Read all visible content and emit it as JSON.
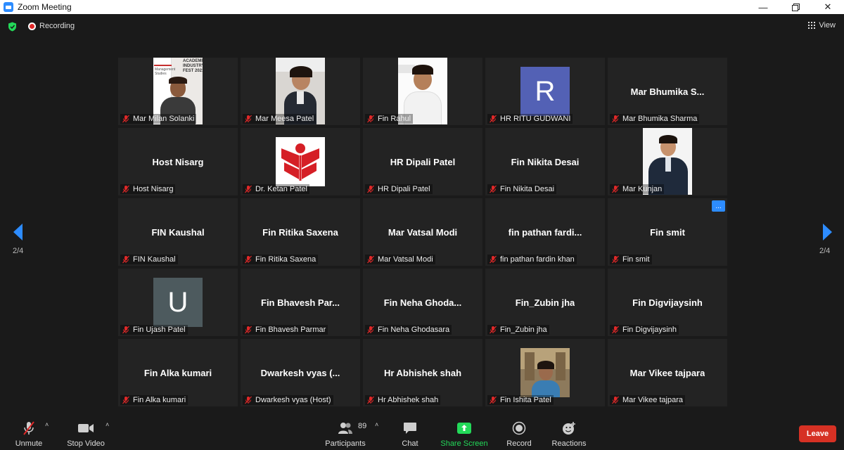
{
  "window": {
    "title": "Zoom Meeting"
  },
  "topbar": {
    "recording_label": "Recording",
    "view_label": "View"
  },
  "gallery": {
    "page_left": "2/4",
    "page_right": "2/4",
    "tiles": [
      {
        "label": "Mar Milan Solanki",
        "kind": "photo",
        "photo_text": [
          "ACADEMIA",
          "INDUSTRY",
          "FEST 2021"
        ],
        "photo_brand": "Management Studies"
      },
      {
        "label": "Mar Meesa Patel",
        "kind": "photo"
      },
      {
        "label": "Fin Rahul",
        "kind": "photo"
      },
      {
        "label": "HR RITU GUDWANI",
        "kind": "letter",
        "letter": "R",
        "color": "#5361b5"
      },
      {
        "label": "Mar Bhumika Sharma",
        "kind": "name",
        "display": "Mar  Bhumika S..."
      },
      {
        "label": "Host Nisarg",
        "kind": "name",
        "display": "Host Nisarg"
      },
      {
        "label": "Dr. Ketan Patel",
        "kind": "logo"
      },
      {
        "label": "HR Dipali Patel",
        "kind": "name",
        "display": "HR Dipali Patel"
      },
      {
        "label": "Fin Nikita Desai",
        "kind": "name",
        "display": "Fin Nikita Desai"
      },
      {
        "label": "Mar Kunjan",
        "kind": "photo"
      },
      {
        "label": "FIN Kaushal",
        "kind": "name",
        "display": "FIN Kaushal"
      },
      {
        "label": "Fin Ritika Saxena",
        "kind": "name",
        "display": "Fin Ritika Saxena"
      },
      {
        "label": "Mar Vatsal Modi",
        "kind": "name",
        "display": "Mar Vatsal Modi"
      },
      {
        "label": "fin pathan fardin khan",
        "kind": "name",
        "display": "fin  pathan  fardi..."
      },
      {
        "label": "Fin smit",
        "kind": "name",
        "display": "Fin smit",
        "more": "..."
      },
      {
        "label": "Fin Ujash Patel",
        "kind": "letter",
        "letter": "U",
        "color": "#4d5a5e"
      },
      {
        "label": "Fin Bhavesh Parmar",
        "kind": "name",
        "display": "Fin  Bhavesh  Par..."
      },
      {
        "label": "Fin Neha Ghodasara",
        "kind": "name",
        "display": "Fin  Neha  Ghoda..."
      },
      {
        "label": "Fin_Zubin jha",
        "kind": "name",
        "display": "Fin_Zubin jha"
      },
      {
        "label": "Fin Digvijaysinh",
        "kind": "name",
        "display": "Fin Digvijaysinh"
      },
      {
        "label": "Fin Alka kumari",
        "kind": "name",
        "display": "Fin Alka kumari"
      },
      {
        "label": "Dwarkesh vyas (Host)",
        "kind": "name",
        "display": "Dwarkesh  vyas  (..."
      },
      {
        "label": "Hr Abhishek shah",
        "kind": "name",
        "display": "Hr Abhishek shah"
      },
      {
        "label": "Fin Ishita Patel",
        "kind": "photo"
      },
      {
        "label": "Mar Vikee tajpara",
        "kind": "name",
        "display": "Mar Vikee tajpara"
      }
    ]
  },
  "toolbar": {
    "unmute": "Unmute",
    "stop_video": "Stop Video",
    "participants": "Participants",
    "participants_count": "89",
    "chat": "Chat",
    "share_screen": "Share Screen",
    "record": "Record",
    "reactions": "Reactions",
    "leave": "Leave"
  },
  "colors": {
    "share_green": "#23d959",
    "leave_red": "#d63124",
    "accent_blue": "#2d8cff"
  }
}
